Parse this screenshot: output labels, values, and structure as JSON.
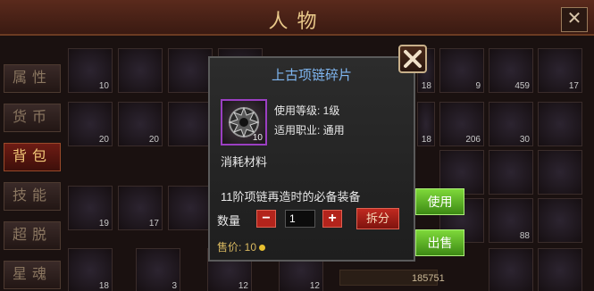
{
  "background": {
    "title": "人物",
    "tabs": [
      {
        "label": "属性",
        "active": false
      },
      {
        "label": "货币",
        "active": false
      },
      {
        "label": "背包",
        "active": true
      },
      {
        "label": "技能",
        "active": false
      },
      {
        "label": "超脱",
        "active": false
      },
      {
        "label": "星魂",
        "active": false
      }
    ],
    "slot_counts": [
      "10",
      "19",
      "20",
      "20",
      "19",
      "17",
      "18",
      "9",
      "459",
      "17",
      "18",
      "206",
      "30",
      "88",
      "12",
      "12",
      "3",
      "18",
      "3"
    ],
    "coins": "185751"
  },
  "popup": {
    "title": "上古项链碎片",
    "item_count": "10",
    "level_line": "使用等级: 1级",
    "class_line": "适用职业: 通用",
    "category": "消耗材料",
    "description": "11阶项链再造时的必备装备",
    "quantity_label": "数量",
    "quantity_value": "1",
    "split_label": "拆分",
    "price_label": "售价: 10"
  },
  "actions": {
    "use_label": "使用",
    "sell_label": "出售"
  },
  "colors": {
    "title_blue": "#7fb6f0",
    "rarity_purple": "#9b3fc2",
    "action_green": "#5ab526",
    "danger_red": "#b3241c",
    "price_gold": "#d8b860"
  }
}
